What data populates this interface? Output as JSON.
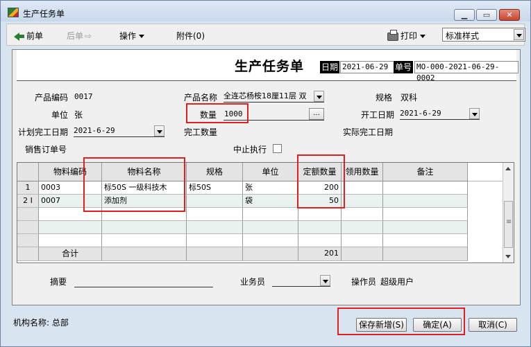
{
  "window": {
    "title": "生产任务单"
  },
  "toolbar": {
    "prev": "前单",
    "next": "后单",
    "operations": "操作",
    "attachments": "附件(0)",
    "print": "打印",
    "style_select": "标准样式"
  },
  "document": {
    "title": "生产任务单",
    "date_label": "日期",
    "date_value": "2021-06-29",
    "number_label": "单号",
    "number_value": "MO-000-2021-06-29-0002"
  },
  "form": {
    "product_code_label": "产品编码",
    "product_code": "0017",
    "product_name_label": "产品名称",
    "product_name": "全连芯杨桉18厘11层 双",
    "spec_label": "规格",
    "spec": "双科",
    "unit_label": "单位",
    "unit": "张",
    "quantity_label": "数量",
    "quantity": "1000",
    "start_date_label": "开工日期",
    "start_date": "2021-6-29",
    "plan_finish_label": "计划完工日期",
    "plan_finish": "2021-6-29",
    "finished_qty_label": "完工数量",
    "actual_finish_label": "实际完工日期",
    "sales_order_label": "销售订单号",
    "stop_label": "中止执行"
  },
  "grid": {
    "columns": [
      "物料编码",
      "物料名称",
      "规格",
      "单位",
      "定额数量",
      "领用数量",
      "备注"
    ],
    "rows": [
      {
        "idx": "1",
        "code": "0003",
        "name": "标50S 一级科技木",
        "spec": "标50S",
        "unit": "张",
        "qty": "200",
        "used": "",
        "note": ""
      },
      {
        "idx": "2",
        "code": "0007",
        "name": "添加剂",
        "spec": "",
        "unit": "袋",
        "qty": "50",
        "used": "",
        "note": ""
      }
    ],
    "total_label": "合计",
    "total_qty": "201"
  },
  "footer_fields": {
    "summary_label": "摘要",
    "salesman_label": "业务员",
    "operator_label": "操作员",
    "operator": "超级用户"
  },
  "status": {
    "org": "机构名称: 总部"
  },
  "buttons": {
    "save_new": "保存新增(S)",
    "ok": "确定(A)",
    "cancel": "取消(C)"
  }
}
